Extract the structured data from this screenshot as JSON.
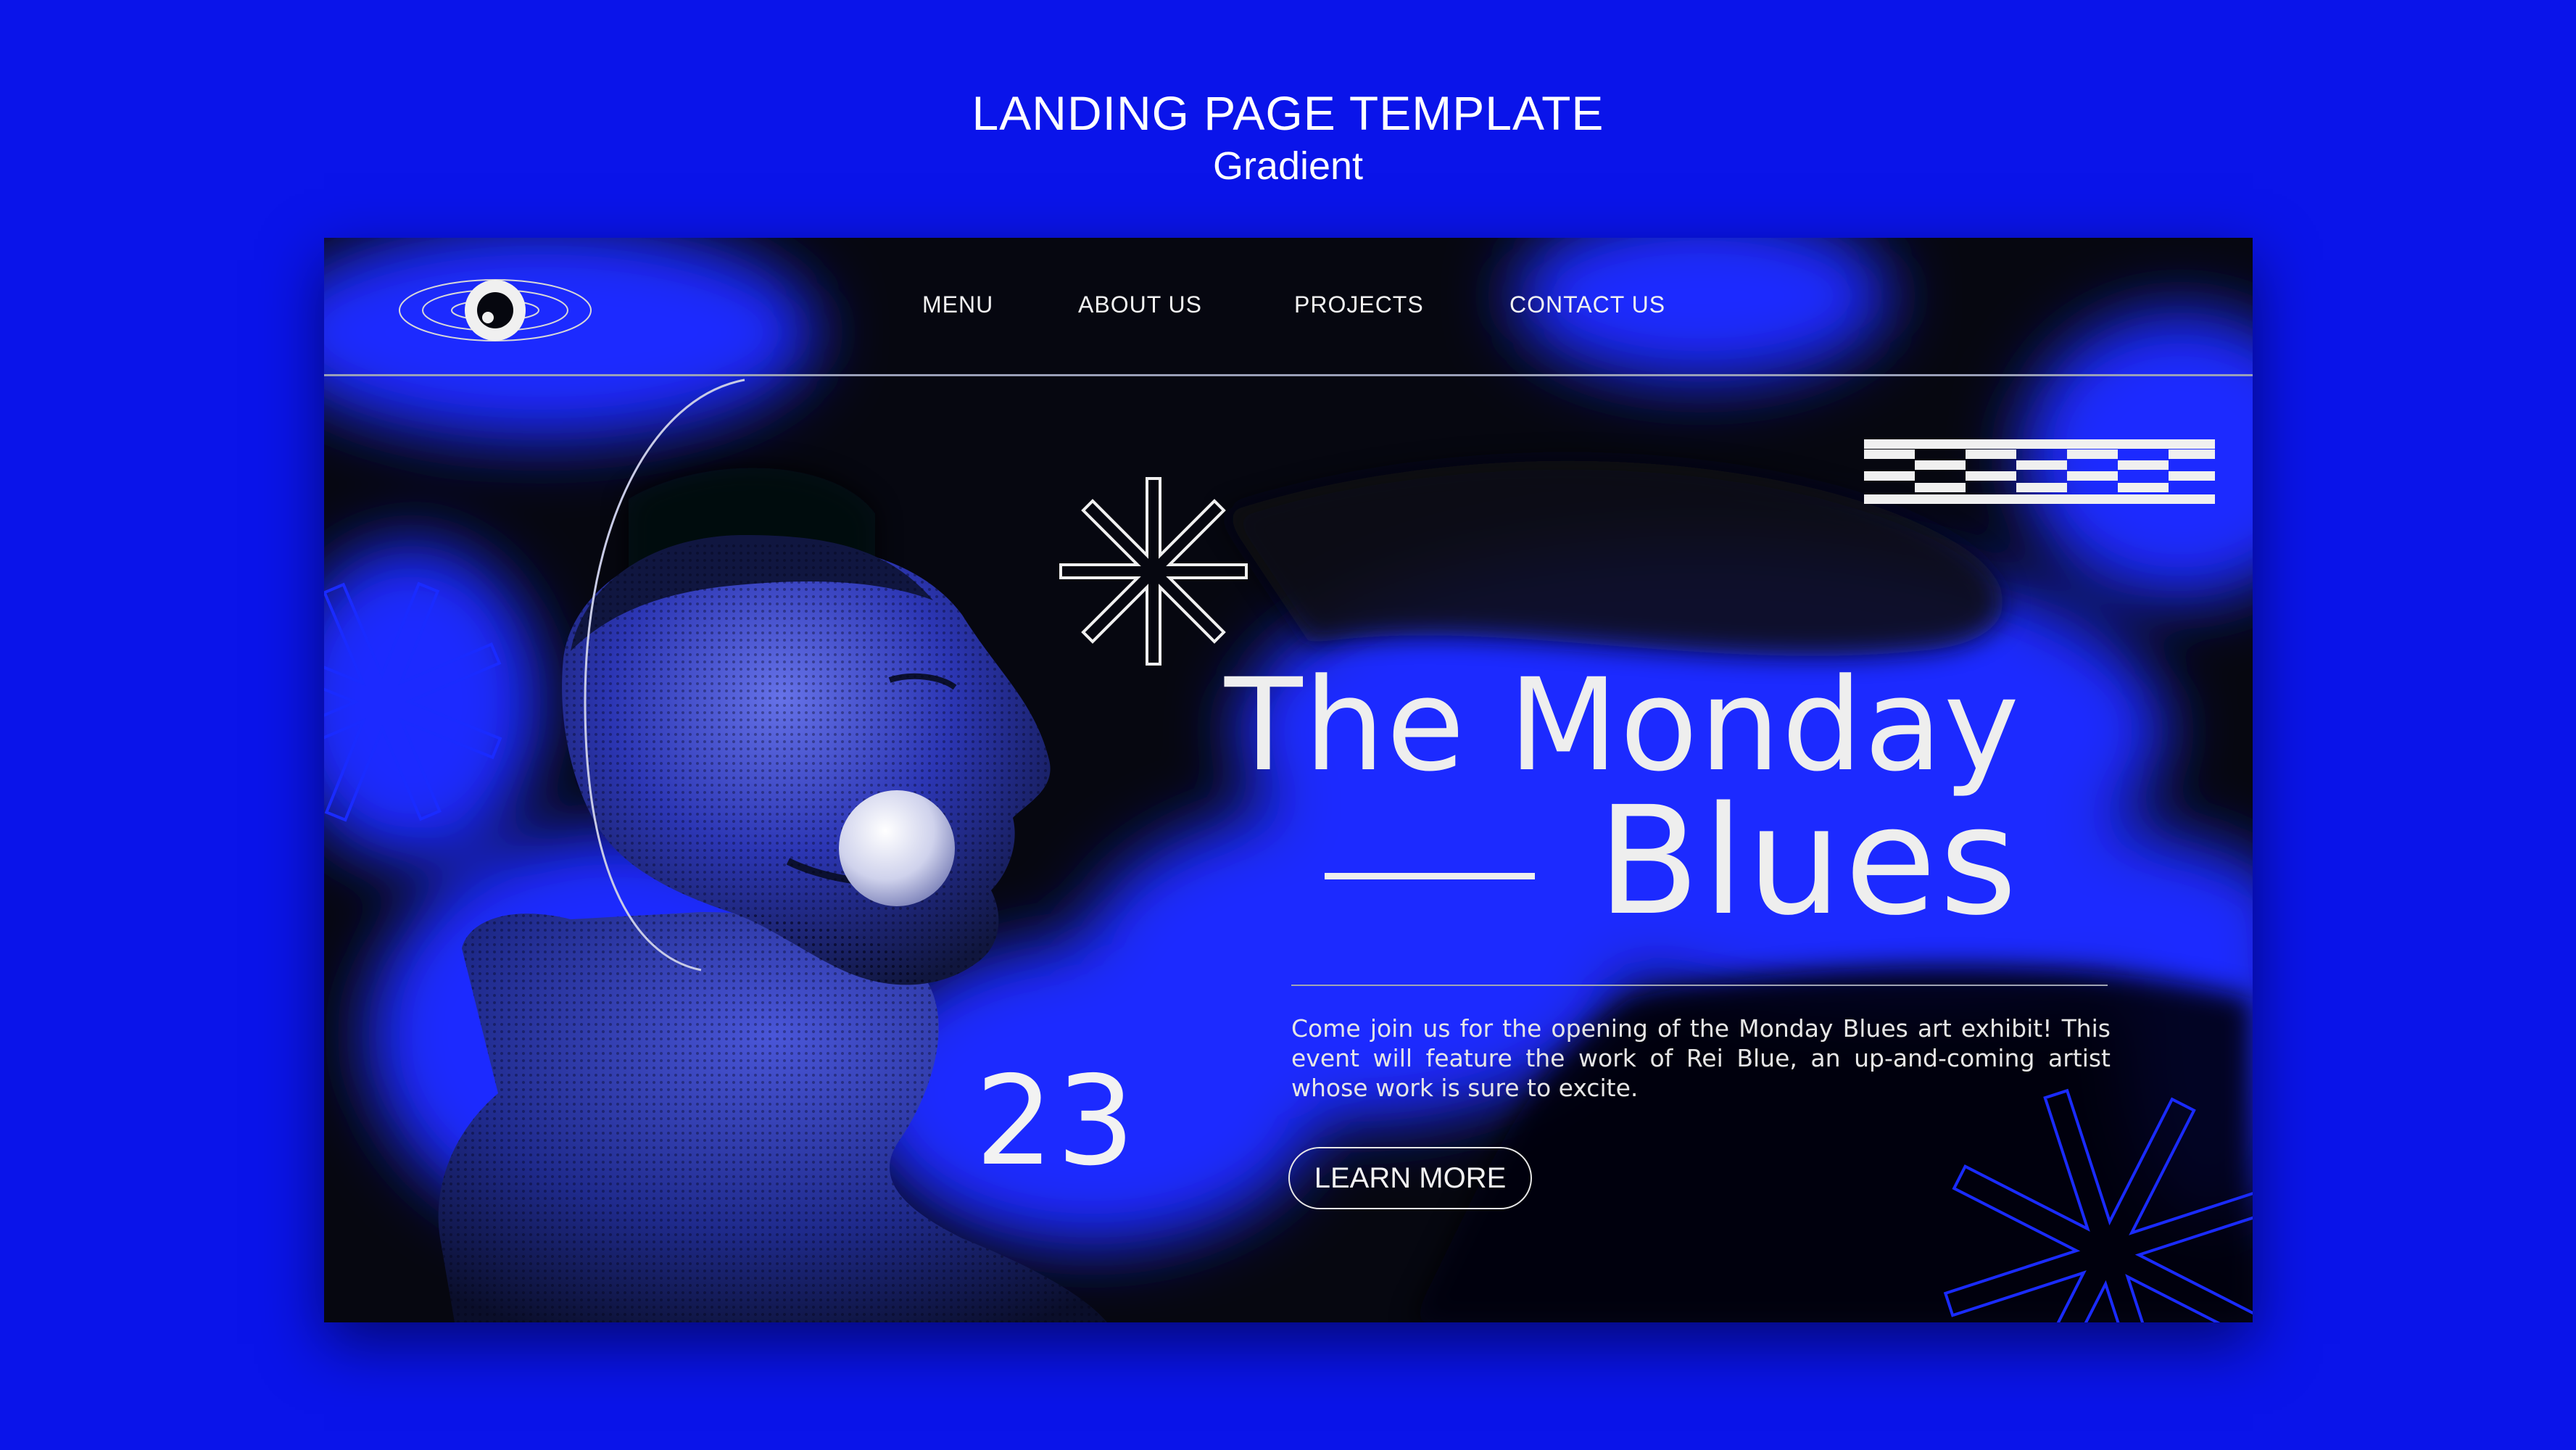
{
  "page": {
    "title": "LANDING PAGE TEMPLATE",
    "subtitle": "Gradient"
  },
  "colors": {
    "background": "#0a14ea",
    "card_bg": "#060710",
    "accent_blue": "#1a2bff",
    "text": "#eeeeee"
  },
  "header": {
    "logo_icon": "eye-icon",
    "nav": [
      {
        "label": "MENU"
      },
      {
        "label": "ABOUT US"
      },
      {
        "label": "PROJECTS"
      },
      {
        "label": "CONTACT US"
      }
    ]
  },
  "hero": {
    "title_line1": "The Monday",
    "title_line2": "Blues",
    "description": "Come join us for the opening of the Monday Blues art exhibit! This event will feature the work of Rei Blue, an up-and-coming artist whose work is sure to excite.",
    "number": "23",
    "cta_label": "LEARN MORE"
  },
  "decor": {
    "icons": [
      "asterisk-icon",
      "checker-stripes-icon",
      "bubble-icon",
      "portrait-image"
    ]
  }
}
